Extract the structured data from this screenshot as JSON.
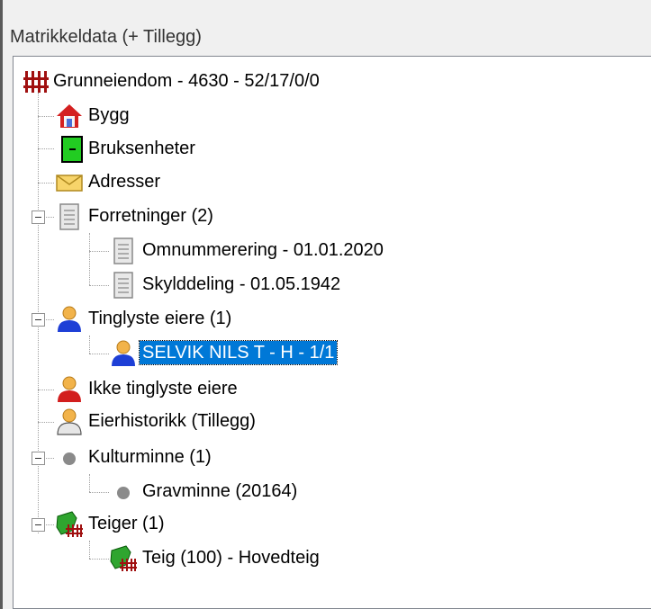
{
  "panel": {
    "title": "Matrikkeldata (+ Tillegg)"
  },
  "tree": {
    "root": {
      "label": "Grunneiendom - 4630 - 52/17/0/0",
      "icon": "property-fence-icon"
    },
    "bygg": {
      "label": "Bygg",
      "icon": "house-icon"
    },
    "bruksenheter": {
      "label": "Bruksenheter",
      "icon": "unit-icon"
    },
    "adresser": {
      "label": "Adresser",
      "icon": "envelope-icon"
    },
    "forretninger": {
      "label": "Forretninger (2)",
      "icon": "document-icon",
      "expanded": true,
      "children": [
        {
          "label": "Omnummerering - 01.01.2020",
          "icon": "document-icon"
        },
        {
          "label": "Skylddeling - 01.05.1942",
          "icon": "document-icon"
        }
      ]
    },
    "tinglyste": {
      "label": "Tinglyste eiere (1)",
      "icon": "person-blue-icon",
      "expanded": true,
      "children": [
        {
          "label": "SELVIK NILS T - H - 1/1",
          "icon": "person-blue-icon",
          "selected": true
        }
      ]
    },
    "ikke_tinglyste": {
      "label": "Ikke tinglyste eiere",
      "icon": "person-red-icon"
    },
    "eierhistorikk": {
      "label": "Eierhistorikk (Tillegg)",
      "icon": "person-grey-icon"
    },
    "kulturminne": {
      "label": "Kulturminne (1)",
      "icon": "grey-dot-icon",
      "expanded": true,
      "children": [
        {
          "label": "Gravminne (20164)",
          "icon": "grey-dot-icon"
        }
      ]
    },
    "teiger": {
      "label": "Teiger (1)",
      "icon": "parcel-icon",
      "expanded": true,
      "children": [
        {
          "label": "Teig (100) - Hovedteig",
          "icon": "parcel-icon"
        }
      ]
    }
  },
  "colors": {
    "selection": "#0078d7",
    "fence": "#a01010",
    "parcel": "#2fa52f",
    "unit": "#22cc22",
    "person_blue": "#1e3fd6",
    "person_red": "#d21e1e"
  }
}
